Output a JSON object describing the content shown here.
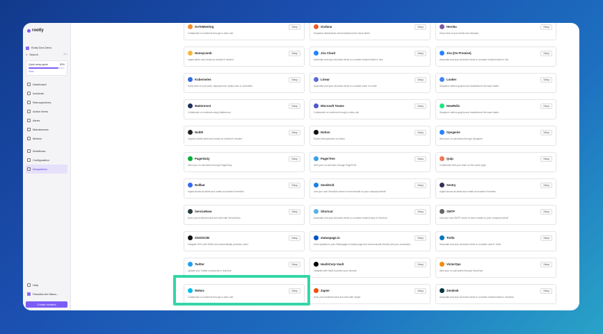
{
  "app": {
    "logo": "rootly"
  },
  "sidebar": {
    "org": "Rootly Docs Demo",
    "search_label": "Search",
    "search_shortcut": "⌘ K",
    "guide": {
      "title": "Quick setup guide",
      "progress_label": "83%",
      "progress": 0.83,
      "view": "View"
    },
    "items": [
      {
        "label": "Dashboard",
        "icon": "dashboard-icon"
      },
      {
        "label": "Incidents",
        "icon": "incidents-icon"
      },
      {
        "label": "Retrospectives",
        "icon": "retro-icon"
      },
      {
        "label": "Action Items",
        "icon": "action-icon"
      },
      {
        "label": "Alerts",
        "icon": "alert-icon"
      },
      {
        "label": "Maintenance",
        "icon": "maintenance-icon"
      },
      {
        "label": "Metrics",
        "icon": "metrics-icon"
      }
    ],
    "items2": [
      {
        "label": "Workflows",
        "icon": "workflow-icon"
      },
      {
        "label": "Configuration",
        "icon": "config-icon"
      },
      {
        "label": "Integrations",
        "icon": "integrations-icon",
        "active": true
      }
    ],
    "help": "Help",
    "user": "Paradise Aid Mana...",
    "create_button": "Create Incident"
  },
  "setup_label": "Setup",
  "integrations": [
    {
      "name": "GoToMeeting",
      "desc": "Collaborate on incidents through a video call",
      "color": "#f68d2e"
    },
    {
      "name": "Grafana",
      "desc": "Snapshot dashboards and troubleshoot the issue faster",
      "color": "#f05a28"
    },
    {
      "name": "Heroku",
      "desc": "Keep track of your builds and releases",
      "color": "#79589f"
    },
    {
      "name": "Honeycomb",
      "desc": "Ingest alerts and create an incident if needed",
      "color": "#f6b83d"
    },
    {
      "name": "Jira Cloud",
      "desc": "Associate and sync all action items to a master incident ticket in Jira",
      "color": "#2684ff"
    },
    {
      "name": "Jira (On Premise)",
      "desc": "Associate and sync all action items to a master incident ticket in Jira",
      "color": "#2684ff"
    },
    {
      "name": "Kubernetes",
      "desc": "Keep track of your pods, deployments, replica sets & controllers",
      "color": "#326ce5"
    },
    {
      "name": "Linear",
      "desc": "Associate and sync all action items to a master issue in Linear",
      "color": "#5e6ad2"
    },
    {
      "name": "Looker",
      "desc": "Snapshot metrics graphs and troubleshoot the issue faster",
      "color": "#4285f4"
    },
    {
      "name": "Mattermost",
      "desc": "Collaborate on incidents using Mattermost",
      "color": "#1e325c"
    },
    {
      "name": "Microsoft Teams",
      "desc": "Collaborate on incidents through a video call",
      "color": "#5059c9"
    },
    {
      "name": "NewRelic",
      "desc": "Snapshot metrics graphs and troubleshoot the issue faster",
      "color": "#1ce783"
    },
    {
      "name": "Nobl9",
      "desc": "Capture Nobl9 alerts and create an incident if needed",
      "color": "#222222"
    },
    {
      "name": "Notion",
      "desc": "Export retrospectives to Notion",
      "color": "#111111"
    },
    {
      "name": "Opsgenie",
      "desc": "Alert your on-call teams through Opsgenie",
      "color": "#2684ff"
    },
    {
      "name": "PagerDuty",
      "desc": "Alert your on-call teams through PagerDuty",
      "color": "#06ac38"
    },
    {
      "name": "PagerTree",
      "desc": "Alert your on-call team through PagerTree",
      "color": "#3aa1e6"
    },
    {
      "name": "Quip",
      "desc": "Collaborate with your team on the same page",
      "color": "#f27557"
    },
    {
      "name": "Rollbar",
      "desc": "Ingest issues as alerts and create an incident if needed",
      "color": "#3569f3"
    },
    {
      "name": "SendGrid",
      "desc": "Use your own SendGrid server to send emails on your company behalf",
      "color": "#1a82e2"
    },
    {
      "name": "Sentry",
      "desc": "Ingest issues as alerts and create an incident if needed",
      "color": "#362d59"
    },
    {
      "name": "ServiceNow",
      "desc": "Sync your incidents back and forth with ServiceNow",
      "color": "#293e40"
    },
    {
      "name": "Shortcut",
      "desc": "Associate and sync all action items to a master incident story in Shortcut",
      "color": "#58b1e4"
    },
    {
      "name": "SMTP",
      "desc": "Use your own SMTP server to send emails on your company behalf",
      "color": "#666666"
    },
    {
      "name": "SSO/SCIM",
      "desc": "Integrate SSO with SAML and automatically provision users",
      "color": "#111111"
    },
    {
      "name": "statuspage.io",
      "desc": "Send updates to your Statuspage to status page and communicate directly with your customers",
      "color": "#0052cc"
    },
    {
      "name": "Trello",
      "desc": "Associate and sync all action items to a master card in Trello",
      "color": "#0079bf"
    },
    {
      "name": "Twitter",
      "desc": "Update your Twitter community in real-time",
      "color": "#1da1f2"
    },
    {
      "name": "HashiCorp Vault",
      "desc": "Integrate with Vault to protect your secrets",
      "color": "#000000"
    },
    {
      "name": "VictorOps",
      "desc": "Alert your on-call teams through VictorOps",
      "color": "#f38b00"
    },
    {
      "name": "Webex",
      "desc": "Collaborate on incidents through a video call",
      "color": "#00bceb"
    },
    {
      "name": "Zapier",
      "desc": "Sync your incidents back and forth with Zapier",
      "color": "#ff4a00"
    },
    {
      "name": "Zendesk",
      "desc": "Associate and sync all action items to a master incident ticket in Zendesk",
      "color": "#03363d"
    }
  ]
}
